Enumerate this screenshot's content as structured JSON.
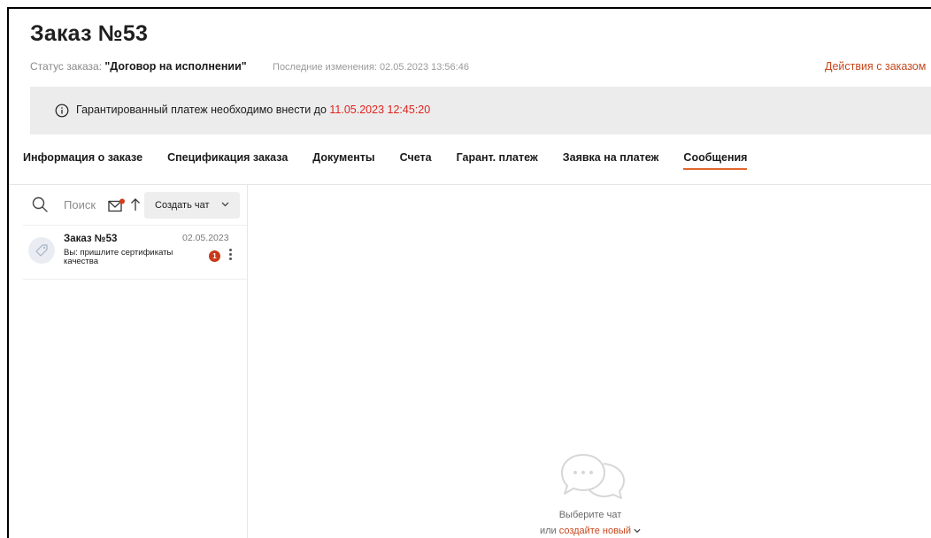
{
  "order": {
    "title": "Заказ №53",
    "status_label": "Статус заказа: ",
    "status_value": "\"Договор на исполнении\"",
    "last_changed": "Последние изменения: 02.05.2023 13:56:46",
    "actions_link": "Действия с заказом"
  },
  "banner": {
    "text": "Гарантированный платеж необходимо внести до ",
    "deadline": "11.05.2023 12:45:20",
    "deadline_color": "#e0231d"
  },
  "tabs": [
    {
      "label": "Информация о заказе",
      "active": false
    },
    {
      "label": "Спецификация заказа",
      "active": false
    },
    {
      "label": "Документы",
      "active": false
    },
    {
      "label": "Счета",
      "active": false
    },
    {
      "label": "Гарант. платеж",
      "active": false
    },
    {
      "label": "Заявка на платеж",
      "active": false
    },
    {
      "label": "Сообщения",
      "active": true
    }
  ],
  "chat_panel": {
    "search_placeholder": "Поиск",
    "create_chat_label": "Создать чат",
    "chats": [
      {
        "title": "Заказ №53",
        "date": "02.05.2023",
        "preview": "Вы: пришлите сертификаты качества",
        "unread": "1",
        "avatar_icon": "tag-icon"
      }
    ]
  },
  "empty_state": {
    "icon": "chat-bubbles-icon",
    "line1": "Выберите чат",
    "line2_prefix": "или ",
    "create_link": "создайте новый"
  },
  "colors": {
    "accent": "#e3672d",
    "link": "#c8471e",
    "badge": "#c8391a",
    "banner_bg": "#ececec"
  }
}
